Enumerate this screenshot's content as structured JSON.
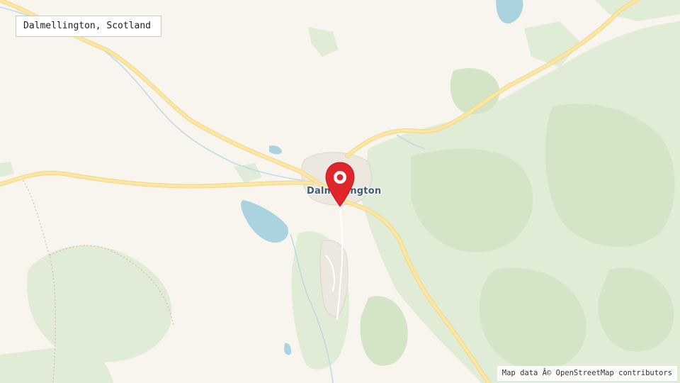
{
  "map": {
    "title": "Dalmellington, Scotland",
    "place_label": "Dalmellington",
    "attribution": "Map data Â© OpenStreetMap contributors",
    "marker_icon": "map-pin-icon",
    "colors": {
      "land": "#f8f5ef",
      "woodland": "#e1ecd6",
      "woodland_dark": "#d4e5c7",
      "water": "#aad3df",
      "road": "#fbe7a3",
      "road_casing": "#f0d78a",
      "marker": "#e0262b",
      "label": "#3f5a72"
    }
  }
}
